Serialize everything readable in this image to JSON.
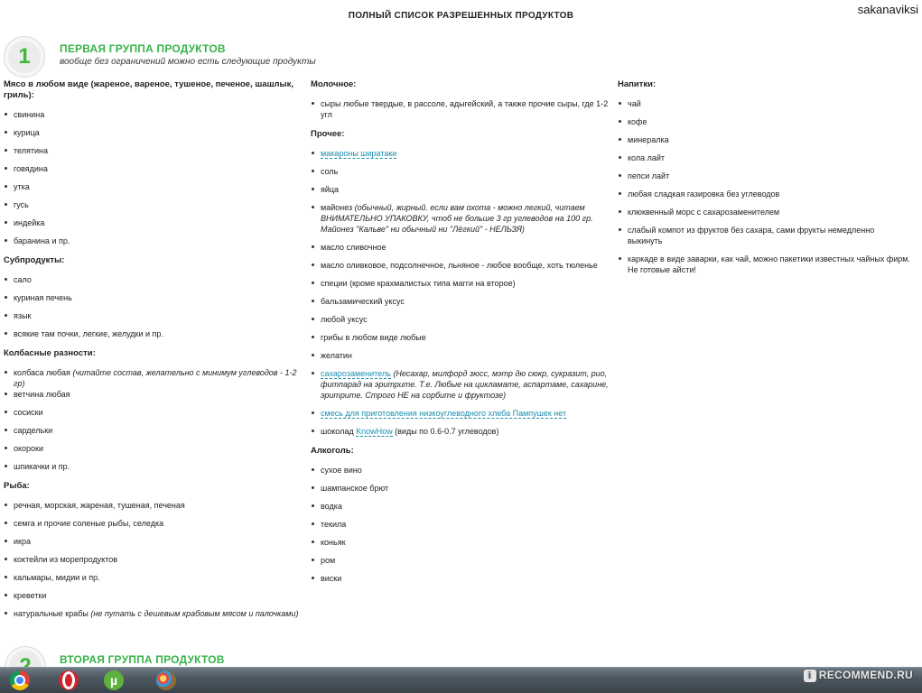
{
  "page": {
    "title": "ПОЛНЫЙ СПИСОК РАЗРЕШЕННЫХ ПРОДУКТОВ",
    "username": "sakanaviksi"
  },
  "group1": {
    "number": "1",
    "title": "ПЕРВАЯ ГРУППА ПРОДУКТОВ",
    "subtitle": "вообще без ограничений можно есть следующие продукты"
  },
  "group2": {
    "number": "2",
    "title": "ВТОРАЯ ГРУППА ПРОДУКТОВ"
  },
  "col1": {
    "meat_heading": "Мясо в любом виде (жареное, вареное, тушеное, печеное, шашлык, гриль):",
    "meat": [
      "свинина",
      "курица",
      "телятина",
      "говядина",
      "утка",
      "гусь",
      "индейка",
      "баранина и пр."
    ],
    "offal_heading": "Субпродукты:",
    "offal": [
      "сало",
      "куриная печень",
      "язык",
      "всякие там почки, легкие, желудки и пр."
    ],
    "sausage_heading": "Колбасные разности:",
    "sausage_first": "колбаса любая",
    "sausage_first_note": "(читайте состав, желательно с минимум углеводов - 1-2 гр)",
    "sausage": [
      "ветчина любая",
      "сосиски",
      "сардельки",
      "окороки",
      "шпикачки и пр."
    ],
    "fish_heading": "Рыба:",
    "fish": [
      "речная, морская, жареная, тушеная, печеная",
      "семга и прочие соленые рыбы, селедка",
      "икра",
      "коктейли из морепродуктов",
      "кальмары, мидии и пр.",
      "креветки"
    ],
    "fish_last": "натуральные крабы",
    "fish_last_note": "(не путать с дешевым крабовым мясом и палочками)"
  },
  "col2": {
    "dairy_heading": "Молочное:",
    "dairy": [
      "сыры любые твердые, в рассоле, адыгейский, а также прочие сыры, где 1-2 угл"
    ],
    "other_heading": "Прочее:",
    "other_link1": "макароны ширатаки",
    "other_a": [
      "соль",
      "яйца"
    ],
    "mayo_main": "майонез",
    "mayo_note": "(обычный, жирный. если вам охота - можно легкий, читаем ВНИМАТЕЛЬНО УПАКОВКУ, чтоб не больше 3 гр углеводов на 100 гр. Майонез \"Кальве\" ни обычный ни \"Лёгкий\" - НЕЛЬЗЯ)",
    "other_b": [
      "масло сливочное",
      "масло оливковое, подсолнечное, льняное - любое вообще, хоть тюленье",
      "специи (кроме крахмалистых типа магги на второе)",
      "бальзамический уксус",
      "любой уксус",
      "грибы в любом виде любые",
      "желатин"
    ],
    "sweetener_link": "сахарозаменитель",
    "sweetener_note": "(Несахар, милфорд зюсс, мэтр дю сюкр, сукразит, рио, фитпарад на эритрите. Т.е. Любые на цикламате, аспартаме, сахарине, эритрите. Строго НЕ на сорбите и фруктозе)",
    "bread_link": "смесь для приготовления низкоуглеводного хлеба Пампушек нет",
    "choc_pre": "шоколад",
    "choc_link": "KnowHow",
    "choc_post": "(виды по 0.6-0.7 углеводов)",
    "alcohol_heading": "Алкоголь:",
    "alcohol": [
      "сухое вино",
      "шампанское брют",
      "водка",
      "текила",
      "коньяк",
      "ром",
      "виски"
    ]
  },
  "col3": {
    "drinks_heading": "Напитки:",
    "drinks": [
      "чай",
      "кофе",
      "минералка",
      "кола лайт",
      "пепси лайт",
      "любая сладкая газировка без углеводов",
      "клюквенный морс с сахарозаменителем",
      "слабый компот из фруктов без сахара, сами фрукты немедленно выкинуть",
      "каркаде в виде заварки, как чай, можно пакетики известных чайных фирм. Не готовые айсти!"
    ]
  },
  "taskbar": {
    "icons": [
      "chrome-icon",
      "opera-icon",
      "utorrent-icon",
      "paint-icon"
    ],
    "utorrent_glyph": "µ"
  },
  "watermark": {
    "logo_glyph": "i",
    "text": "RECOMMEND.RU"
  },
  "colors": {
    "accent_green": "#37b34a",
    "link_blue": "#1a8fb0"
  }
}
